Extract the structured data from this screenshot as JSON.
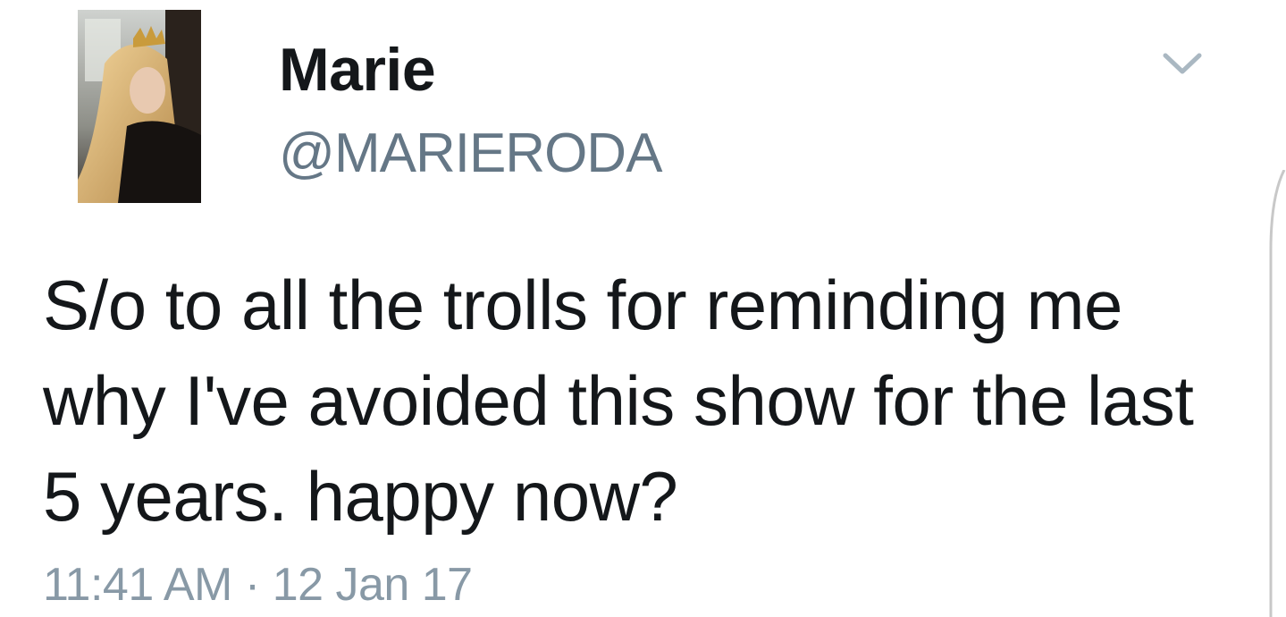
{
  "tweet": {
    "display_name": "Marie",
    "handle": "@MARIERODA",
    "text": "S/o to all the trolls for reminding me\nwhy I've avoided this show for the last\n5 years. happy now?",
    "time": "11:41 AM",
    "separator": "·",
    "date": "12 Jan 17",
    "menu_icon": "chevron-down-icon",
    "avatar_icon": "profile-photo"
  },
  "colors": {
    "text": "#14171a",
    "secondary": "#657786",
    "timestamp": "#8899a6",
    "chevron": "#aab8c2",
    "background": "#ffffff"
  }
}
